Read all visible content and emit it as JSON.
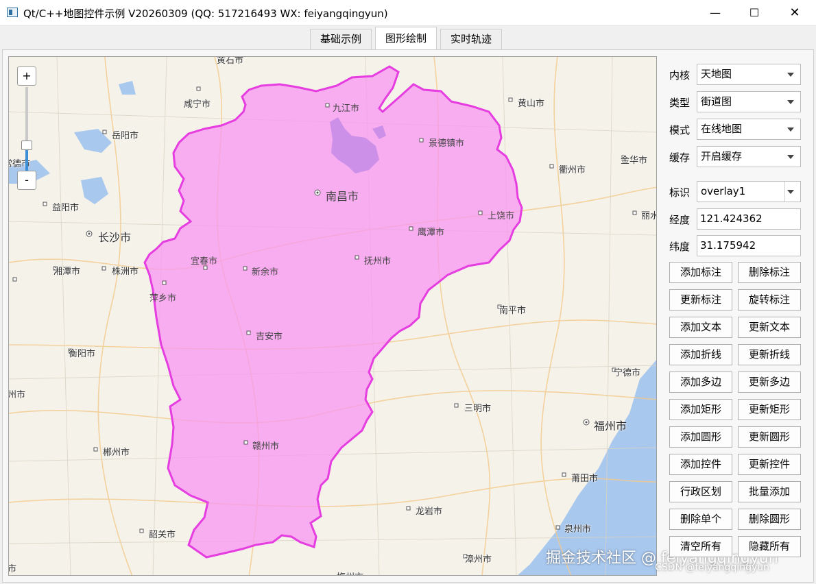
{
  "window": {
    "title": "Qt/C++地图控件示例 V20260309 (QQ: 517216493 WX: feiyangqingyun)",
    "min_glyph": "—",
    "max_glyph": "☐",
    "close_glyph": "✕"
  },
  "tabs": [
    {
      "label": "基础示例",
      "active": false
    },
    {
      "label": "图形绘制",
      "active": true
    },
    {
      "label": "实时轨迹",
      "active": false
    }
  ],
  "map": {
    "zoom_in": "+",
    "zoom_out": "-",
    "zoom_level_fraction": 0.3,
    "region_fill": "#f79af0",
    "region_stroke": "#e53de0",
    "water_color": "#a9c8ee",
    "cities_inside": [
      "九江市",
      "景德镇市",
      "南昌市",
      "上饶市",
      "鹰潭市",
      "宜春市",
      "新余市",
      "抚州市",
      "萍乡市",
      "吉安市",
      "赣州市"
    ],
    "cities_outside": [
      "黄石市",
      "咸宁市",
      "黄山市",
      "岳阳市",
      "衢州市",
      "金华市",
      "常德市",
      "益阳市",
      "长沙市",
      "丽水",
      "湘潭市",
      "株洲市",
      "南平市",
      "衡阳市",
      "宁德市",
      "三明市",
      "福州市",
      "郴州市",
      "莆田市",
      "龙岩市",
      "韶关市",
      "泉州市",
      "漳州市",
      "州市",
      "梅州市",
      "市"
    ]
  },
  "panel": {
    "kernel": {
      "label": "内核",
      "value": "天地图"
    },
    "type": {
      "label": "类型",
      "value": "街道图"
    },
    "mode": {
      "label": "模式",
      "value": "在线地图"
    },
    "cache": {
      "label": "缓存",
      "value": "开启缓存"
    },
    "ident": {
      "label": "标识",
      "value": "overlay1"
    },
    "lng": {
      "label": "经度",
      "value": "121.424362"
    },
    "lat": {
      "label": "纬度",
      "value": "31.175942"
    },
    "buttons": [
      [
        "添加标注",
        "删除标注"
      ],
      [
        "更新标注",
        "旋转标注"
      ],
      [
        "添加文本",
        "更新文本"
      ],
      [
        "添加折线",
        "更新折线"
      ],
      [
        "添加多边",
        "更新多边"
      ],
      [
        "添加矩形",
        "更新矩形"
      ],
      [
        "添加圆形",
        "更新圆形"
      ],
      [
        "添加控件",
        "更新控件"
      ],
      [
        "行政区划",
        "批量添加"
      ],
      [
        "删除单个",
        "删除圆形"
      ],
      [
        "清空所有",
        "隐藏所有"
      ]
    ]
  },
  "watermark": {
    "main": "掘金技术社区 @ feiyangqingyun",
    "sub": "CSDN @feiyangqingyun"
  }
}
